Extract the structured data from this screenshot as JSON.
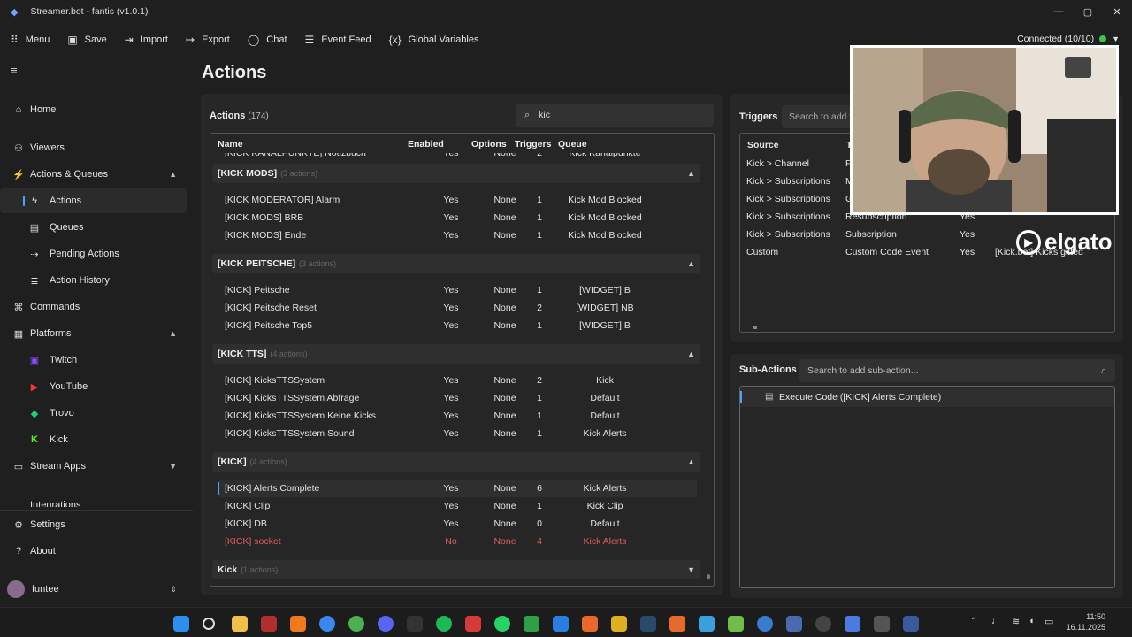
{
  "window": {
    "title": "Streamer.bot - fantis (v1.0.1)"
  },
  "toolbar": {
    "items": [
      {
        "label": "Menu",
        "icon": "grid-icon"
      },
      {
        "label": "Save",
        "icon": "save-icon"
      },
      {
        "label": "Import",
        "icon": "import-icon"
      },
      {
        "label": "Export",
        "icon": "export-icon"
      },
      {
        "label": "Chat",
        "icon": "chat-icon"
      },
      {
        "label": "Event Feed",
        "icon": "list-icon"
      },
      {
        "label": "Global Variables",
        "icon": "variable-icon"
      }
    ],
    "connection": "Connected (10/10)",
    "connection_color": "#3ec64b"
  },
  "sidebar": {
    "items": [
      {
        "label": "Home",
        "icon": "home-icon"
      },
      {
        "label": "Viewers",
        "icon": "people-icon"
      },
      {
        "label": "Actions & Queues",
        "icon": "actions-icon"
      },
      {
        "label": "Actions",
        "icon": "bolt-icon"
      },
      {
        "label": "Queues",
        "icon": "queue-icon"
      },
      {
        "label": "Pending Actions",
        "icon": "pending-icon"
      },
      {
        "label": "Action History",
        "icon": "history-icon"
      },
      {
        "label": "Commands",
        "icon": "command-icon"
      },
      {
        "label": "Platforms",
        "icon": "platforms-icon"
      },
      {
        "label": "Twitch",
        "icon": "twitch-icon"
      },
      {
        "label": "YouTube",
        "icon": "youtube-icon"
      },
      {
        "label": "Trovo",
        "icon": "trovo-icon"
      },
      {
        "label": "Kick",
        "icon": "kick-icon"
      },
      {
        "label": "Stream Apps",
        "icon": "apps-icon"
      },
      {
        "label": "Integrations",
        "icon": "integrations-icon"
      },
      {
        "label": "Settings",
        "icon": "gear-icon"
      },
      {
        "label": "About",
        "icon": "question-icon"
      }
    ],
    "user": "funtee"
  },
  "page": {
    "title": "Actions"
  },
  "actions": {
    "title": "Actions",
    "count": "(174)",
    "search_value": "kic",
    "columns": [
      "Name",
      "Enabled",
      "Options",
      "Triggers",
      "Queue"
    ],
    "partial_row": {
      "name": "[KICK KANALPUNKTE] Notizbuch",
      "enabled": "Yes",
      "options": "None",
      "triggers": "2",
      "queue": "Kick Kanalpunkte"
    },
    "groups": [
      {
        "name": "[KICK MODS]",
        "count": "(3 actions)",
        "rows": [
          {
            "name": "[KICK MODERATOR] Alarm",
            "enabled": "Yes",
            "options": "None",
            "triggers": "1",
            "queue": "Kick Mod Blocked"
          },
          {
            "name": "[KICK MODS] BRB",
            "enabled": "Yes",
            "options": "None",
            "triggers": "1",
            "queue": "Kick Mod Blocked"
          },
          {
            "name": "[KICK MODS] Ende",
            "enabled": "Yes",
            "options": "None",
            "triggers": "1",
            "queue": "Kick Mod Blocked"
          }
        ]
      },
      {
        "name": "[KICK PEITSCHE]",
        "count": "(3 actions)",
        "rows": [
          {
            "name": "[KICK] Peitsche",
            "enabled": "Yes",
            "options": "None",
            "triggers": "1",
            "queue": "[WIDGET] B"
          },
          {
            "name": "[KICK] Peitsche Reset",
            "enabled": "Yes",
            "options": "None",
            "triggers": "2",
            "queue": "[WIDGET] NB"
          },
          {
            "name": "[KICK] Peitsche Top5",
            "enabled": "Yes",
            "options": "None",
            "triggers": "1",
            "queue": "[WIDGET] B"
          }
        ]
      },
      {
        "name": "[KICK TTS]",
        "count": "(4 actions)",
        "rows": [
          {
            "name": "[KICK] KicksTTSSystem",
            "enabled": "Yes",
            "options": "None",
            "triggers": "2",
            "queue": "Kick"
          },
          {
            "name": "[KICK] KicksTTSSystem Abfrage",
            "enabled": "Yes",
            "options": "None",
            "triggers": "1",
            "queue": "Default"
          },
          {
            "name": "[KICK] KicksTTSSystem Keine Kicks",
            "enabled": "Yes",
            "options": "None",
            "triggers": "1",
            "queue": "Default"
          },
          {
            "name": "[KICK] KicksTTSSystem Sound",
            "enabled": "Yes",
            "options": "None",
            "triggers": "1",
            "queue": "Kick Alerts"
          }
        ]
      },
      {
        "name": "[KICK]",
        "count": "(4 actions)",
        "rows": [
          {
            "name": "[KICK] Alerts Complete",
            "enabled": "Yes",
            "options": "None",
            "triggers": "6",
            "queue": "Kick Alerts"
          },
          {
            "name": "[KICK] Clip",
            "enabled": "Yes",
            "options": "None",
            "triggers": "1",
            "queue": "Kick Clip"
          },
          {
            "name": "[KICK] DB",
            "enabled": "Yes",
            "options": "None",
            "triggers": "0",
            "queue": "Default"
          },
          {
            "name": "[KICK] socket",
            "enabled": "No",
            "options": "None",
            "triggers": "4",
            "queue": "Kick Alerts"
          }
        ]
      },
      {
        "name": "Kick",
        "count": "(1 actions)",
        "rows": []
      }
    ]
  },
  "triggers": {
    "title": "Triggers",
    "search_placeholder": "Search to add t",
    "columns": [
      "Source",
      "T"
    ],
    "rows": [
      {
        "source": "Kick > Channel",
        "type": "F",
        "enabled": ""
      },
      {
        "source": "Kick > Subscriptions",
        "type": "M",
        "enabled": ""
      },
      {
        "source": "Kick > Subscriptions",
        "type": "G",
        "enabled": ""
      },
      {
        "source": "Kick > Subscriptions",
        "type": "Resubscription",
        "enabled": "Yes"
      },
      {
        "source": "Kick > Subscriptions",
        "type": "Subscription",
        "enabled": "Yes"
      },
      {
        "source": "Custom",
        "type": "Custom Code Event",
        "enabled": "Yes",
        "extra": "[Kick.bot] Kicks gifted"
      }
    ]
  },
  "subactions": {
    "title": "Sub-Actions",
    "search_placeholder": "Search to add sub-action...",
    "items": [
      "Execute Code ([KICK] Alerts Complete)"
    ]
  },
  "overlay": {
    "watermark": "elgato"
  },
  "taskbar": {
    "time": "11:50",
    "date": "16.11.2025"
  }
}
